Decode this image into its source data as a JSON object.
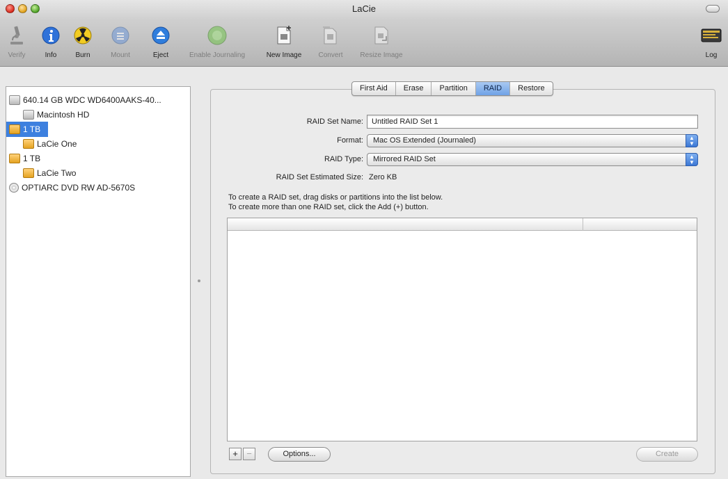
{
  "window": {
    "title": "LaCie"
  },
  "toolbar": {
    "items": [
      {
        "label": "Verify",
        "icon": "microscope-icon",
        "enabled": false
      },
      {
        "label": "Info",
        "icon": "info-icon",
        "enabled": true
      },
      {
        "label": "Burn",
        "icon": "burn-icon",
        "enabled": true
      },
      {
        "label": "Mount",
        "icon": "mount-icon",
        "enabled": false
      },
      {
        "label": "Eject",
        "icon": "eject-icon",
        "enabled": true
      },
      {
        "label": "Enable Journaling",
        "icon": "journaling-icon",
        "enabled": false
      },
      {
        "label": "New Image",
        "icon": "new-image-icon",
        "enabled": true
      },
      {
        "label": "Convert",
        "icon": "convert-icon",
        "enabled": false
      },
      {
        "label": "Resize Image",
        "icon": "resize-image-icon",
        "enabled": false
      },
      {
        "label": "Log",
        "icon": "log-icon",
        "enabled": true
      }
    ]
  },
  "sidebar": {
    "items": [
      {
        "label": "640.14 GB WDC WD6400AAKS-40...",
        "type": "internal-disk",
        "level": 0,
        "selected": false
      },
      {
        "label": "Macintosh HD",
        "type": "internal-volume",
        "level": 1,
        "selected": false
      },
      {
        "label": "1 TB",
        "type": "external-disk",
        "level": 0,
        "selected": true
      },
      {
        "label": "LaCie One",
        "type": "external-volume",
        "level": 1,
        "selected": false
      },
      {
        "label": "1 TB",
        "type": "external-disk",
        "level": 0,
        "selected": false
      },
      {
        "label": "LaCie Two",
        "type": "external-volume",
        "level": 1,
        "selected": false
      },
      {
        "label": "OPTIARC DVD RW AD-5670S",
        "type": "optical-drive",
        "level": 0,
        "selected": false
      }
    ]
  },
  "tabs": {
    "items": [
      "First Aid",
      "Erase",
      "Partition",
      "RAID",
      "Restore"
    ],
    "active": "RAID"
  },
  "raid": {
    "name_label": "RAID Set Name:",
    "name_value": "Untitled RAID Set 1",
    "format_label": "Format:",
    "format_value": "Mac OS Extended (Journaled)",
    "type_label": "RAID Type:",
    "type_value": "Mirrored RAID Set",
    "size_label": "RAID Set Estimated Size:",
    "size_value": "Zero KB",
    "instruction_1": "To create a RAID set, drag disks or partitions into the list below.",
    "instruction_2": "To create more than one RAID set, click the Add (+) button.",
    "list_headers": [
      "",
      ""
    ]
  },
  "buttons": {
    "add": "+",
    "remove": "−",
    "options": "Options...",
    "create": "Create"
  },
  "colors": {
    "selection": "#3d80df",
    "active_tab": "#6fa2e6"
  }
}
